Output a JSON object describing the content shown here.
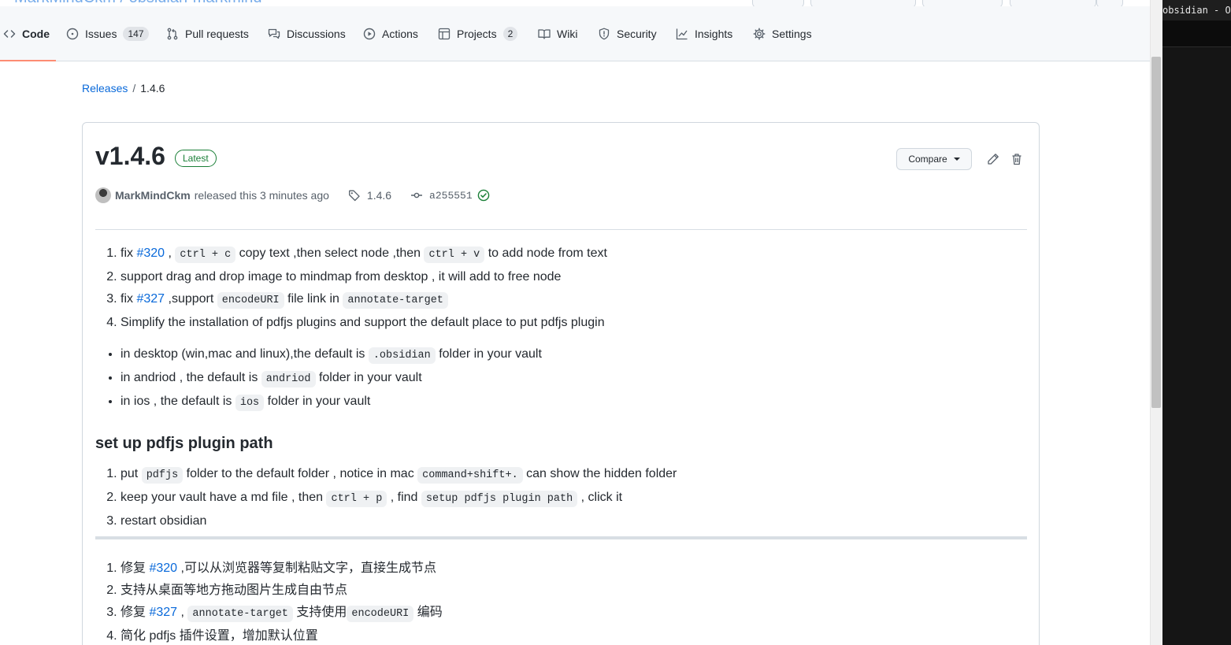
{
  "repo_header": {
    "title_fragment": "MarkMindCkm / obsidian-markmind"
  },
  "tabs": [
    {
      "id": "code",
      "label": "Code",
      "count": null,
      "active": true,
      "icon": "code-icon"
    },
    {
      "id": "issues",
      "label": "Issues",
      "count": "147",
      "active": false,
      "icon": "issue-opened-icon"
    },
    {
      "id": "pulls",
      "label": "Pull requests",
      "count": null,
      "active": false,
      "icon": "git-pull-request-icon"
    },
    {
      "id": "discussions",
      "label": "Discussions",
      "count": null,
      "active": false,
      "icon": "comment-discussion-icon"
    },
    {
      "id": "actions",
      "label": "Actions",
      "count": null,
      "active": false,
      "icon": "play-icon"
    },
    {
      "id": "projects",
      "label": "Projects",
      "count": "2",
      "active": false,
      "icon": "table-icon"
    },
    {
      "id": "wiki",
      "label": "Wiki",
      "count": null,
      "active": false,
      "icon": "book-icon"
    },
    {
      "id": "security",
      "label": "Security",
      "count": null,
      "active": false,
      "icon": "shield-icon"
    },
    {
      "id": "insights",
      "label": "Insights",
      "count": null,
      "active": false,
      "icon": "graph-icon"
    },
    {
      "id": "settings",
      "label": "Settings",
      "count": null,
      "active": false,
      "icon": "gear-icon"
    }
  ],
  "breadcrumb": {
    "parent": "Releases",
    "separator": "/",
    "current": "1.4.6"
  },
  "release": {
    "title": "v1.4.6",
    "badge": "Latest",
    "compare_label": "Compare",
    "author": "MarkMindCkm",
    "released_text": "released this 3 minutes ago",
    "tag": "1.4.6",
    "commit": "a255551"
  },
  "notes_en": {
    "ol1": {
      "i1": {
        "a": "fix ",
        "link": "#320",
        "b": " , ",
        "code1": "ctrl + c",
        "c": " copy text ,then select node ,then ",
        "code2": "ctrl + v",
        "d": " to add node from text"
      },
      "i2": "support drag and drop image to mindmap from desktop , it will add to free node",
      "i3": {
        "a": "fix ",
        "link": "#327",
        "b": " ,support ",
        "code1": "encodeURI",
        "c": " file link in ",
        "code2": "annotate-target"
      },
      "i4": "Simplify the installation of pdfjs plugins and support the default place to put pdfjs plugin"
    },
    "ul": {
      "i1": {
        "a": "in desktop (win,mac and linux),the default is ",
        "code": ".obsidian",
        "b": " folder in your vault"
      },
      "i2": {
        "a": "in andriod , the default is ",
        "code": "andriod",
        "b": " folder in your vault"
      },
      "i3": {
        "a": "in ios , the default is ",
        "code": "ios",
        "b": " folder in your vault"
      }
    },
    "heading": "set up pdfjs plugin path",
    "ol2": {
      "i1": {
        "a": "put ",
        "code1": "pdfjs",
        "b": " folder to the default folder , notice in mac ",
        "code2": "command+shift+.",
        "c": " can show the hidden folder"
      },
      "i2": {
        "a": "keep your vault have a md file , then ",
        "code1": "ctrl + p",
        "b": " , find ",
        "code2": "setup pdfjs plugin path",
        "c": " , click it"
      },
      "i3": "restart obsidian"
    }
  },
  "notes_zh": {
    "i1": {
      "a": "修复 ",
      "link": "#320",
      "b": " ,可以从浏览器等复制粘贴文字，直接生成节点"
    },
    "i2": "支持从桌面等地方拖动图片生成自由节点",
    "i3": {
      "a": "修复 ",
      "link": "#327",
      "b": " , ",
      "code1": "annotate-target",
      "c": " 支持使用",
      "code2": "encodeURI",
      "d": " 编码"
    },
    "i4": "简化 pdfjs 插件设置，增加默认位置"
  },
  "side_window": {
    "title": "obsidian - Obsidian"
  },
  "colors": {
    "link": "#0969da",
    "latest_green": "#1a7f37",
    "tab_underline": "#fd8c73"
  }
}
